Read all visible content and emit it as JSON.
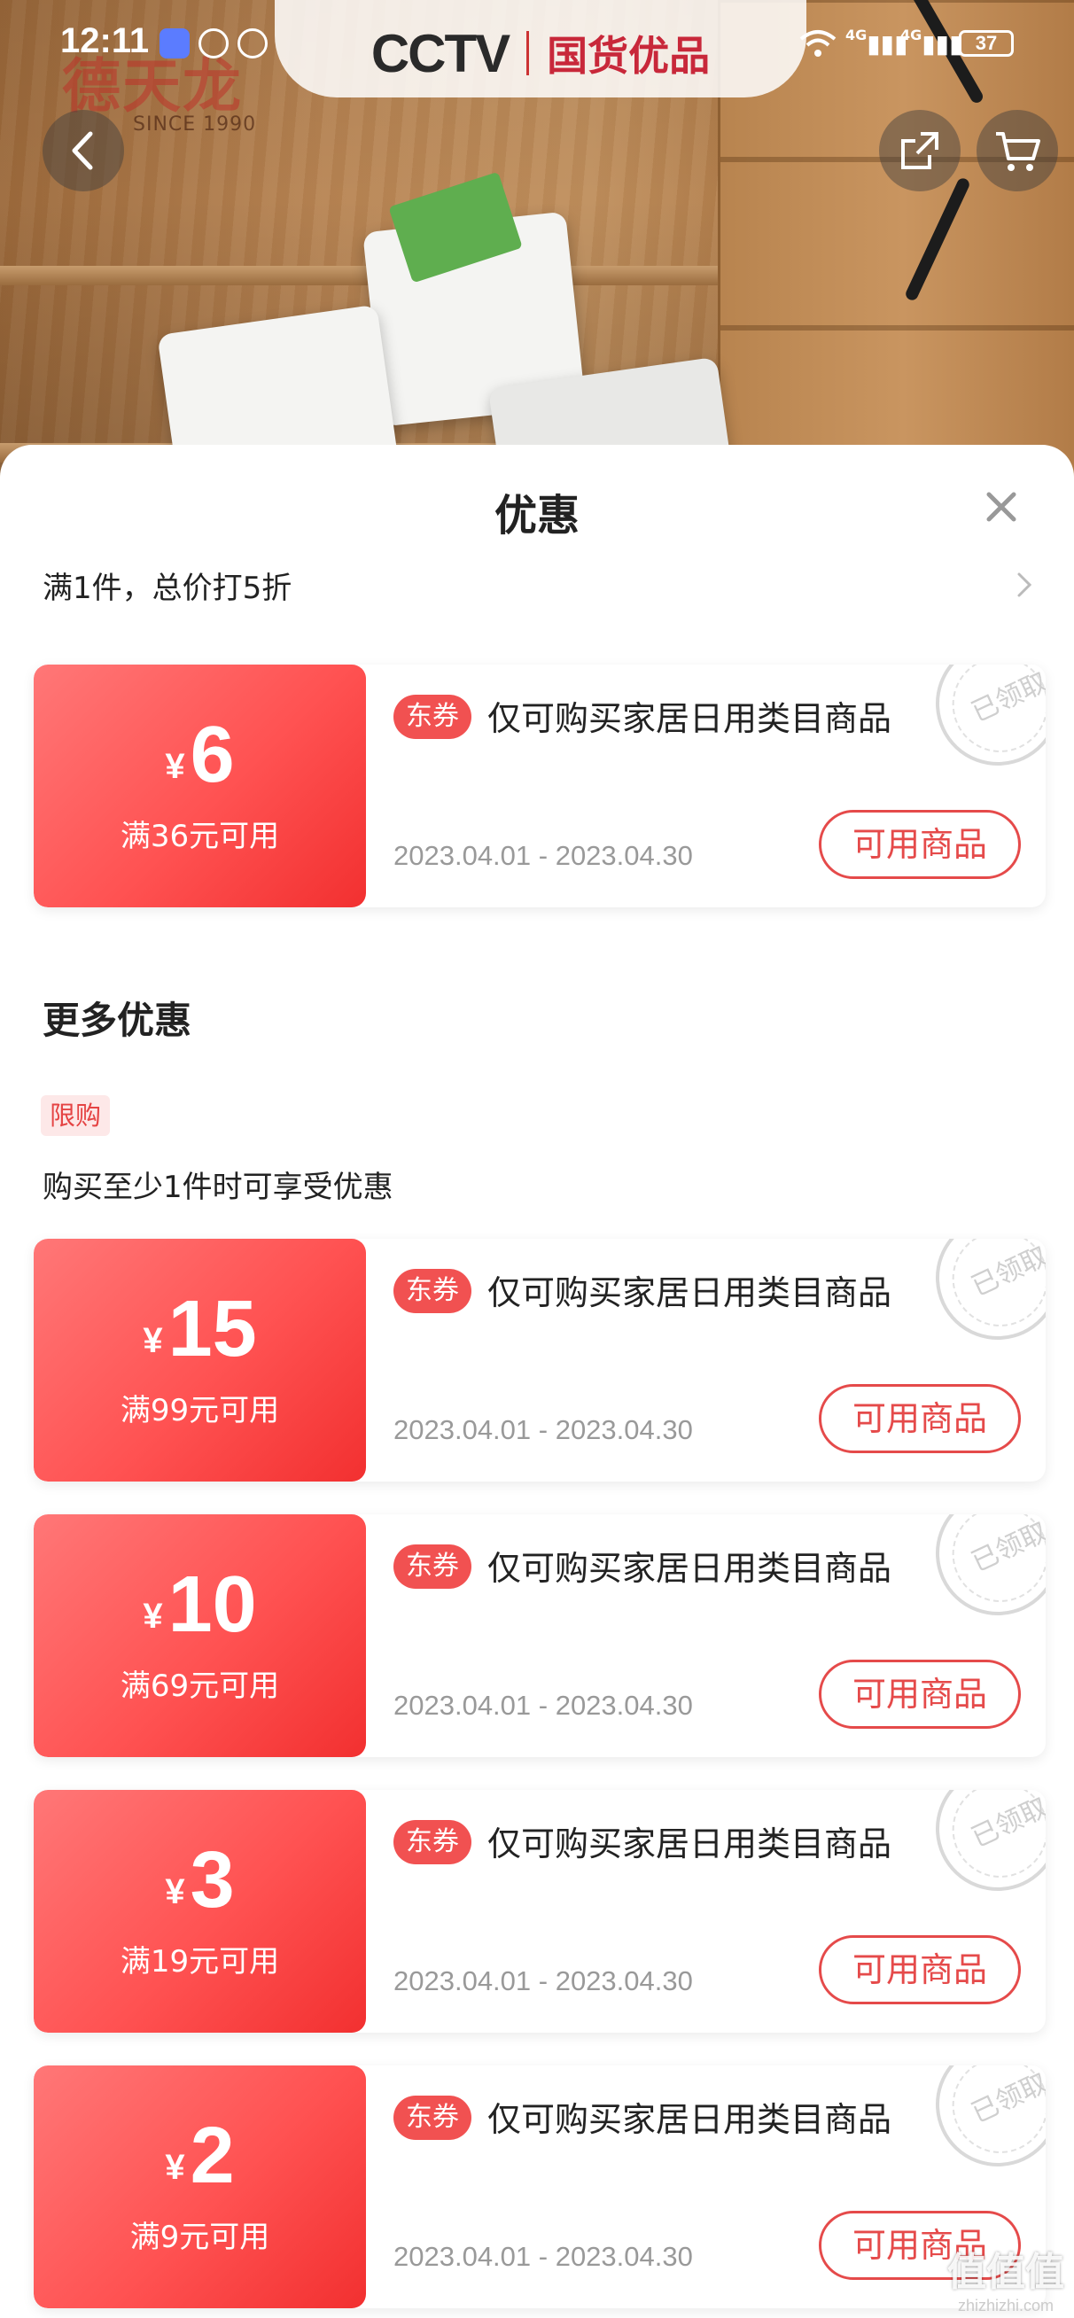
{
  "status_bar": {
    "time": "12:11",
    "signal_1": "4G",
    "signal_2": "4G",
    "battery": "37"
  },
  "header": {
    "logo_text": "德天龙",
    "logo_since": "SINCE 1990",
    "brand_cctv": "CCTV",
    "brand_sub": "国货优品"
  },
  "sheet": {
    "title": "优惠",
    "promo_line": "满1件，总价打5折",
    "section_title": "更多优惠",
    "limit_tag": "限购",
    "limit_desc": "购买至少1件时可享受优惠"
  },
  "coupons": [
    {
      "yen": "¥",
      "amount": "6",
      "threshold": "满36元可用",
      "tag": "东券",
      "desc": "仅可购买家居日用类目商品",
      "dates": "2023.04.01 - 2023.04.30",
      "button": "可用商品",
      "stamp": "已领取"
    },
    {
      "yen": "¥",
      "amount": "15",
      "threshold": "满99元可用",
      "tag": "东券",
      "desc": "仅可购买家居日用类目商品",
      "dates": "2023.04.01 - 2023.04.30",
      "button": "可用商品",
      "stamp": "已领取"
    },
    {
      "yen": "¥",
      "amount": "10",
      "threshold": "满69元可用",
      "tag": "东券",
      "desc": "仅可购买家居日用类目商品",
      "dates": "2023.04.01 - 2023.04.30",
      "button": "可用商品",
      "stamp": "已领取"
    },
    {
      "yen": "¥",
      "amount": "3",
      "threshold": "满19元可用",
      "tag": "东券",
      "desc": "仅可购买家居日用类目商品",
      "dates": "2023.04.01 - 2023.04.30",
      "button": "可用商品",
      "stamp": "已领取"
    },
    {
      "yen": "¥",
      "amount": "2",
      "threshold": "满9元可用",
      "tag": "东券",
      "desc": "仅可购买家居日用类目商品",
      "dates": "2023.04.01 - 2023.04.30",
      "button": "可用商品",
      "stamp": "已领取"
    }
  ],
  "watermark": {
    "main": "值值值",
    "sub": "zhizhizhi.com"
  },
  "colors": {
    "accent_red": "#e54a4a",
    "coupon_gradient_start": "#ff7777",
    "coupon_gradient_end": "#f23030",
    "date_gray": "#999999"
  },
  "icons": {
    "back": "chevron-left-icon",
    "share": "share-icon",
    "cart": "cart-icon",
    "close": "close-icon",
    "more": "chevron-right-icon"
  }
}
